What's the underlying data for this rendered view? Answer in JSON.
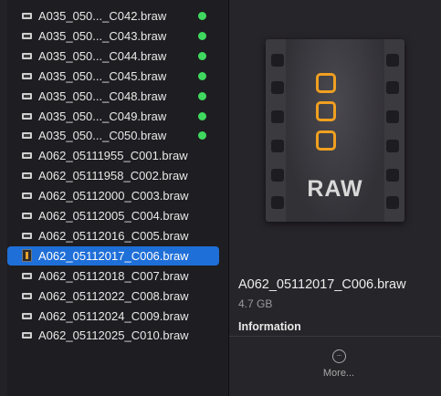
{
  "file_list": [
    {
      "name": "A035_050..._C042.braw",
      "tag": "green"
    },
    {
      "name": "A035_050..._C043.braw",
      "tag": "green"
    },
    {
      "name": "A035_050..._C044.braw",
      "tag": "green"
    },
    {
      "name": "A035_050..._C045.braw",
      "tag": "green"
    },
    {
      "name": "A035_050..._C048.braw",
      "tag": "green"
    },
    {
      "name": "A035_050..._C049.braw",
      "tag": "green"
    },
    {
      "name": "A035_050..._C050.braw",
      "tag": "green"
    },
    {
      "name": "A062_05111955_C001.braw",
      "tag": null
    },
    {
      "name": "A062_05111958_C002.braw",
      "tag": null
    },
    {
      "name": "A062_05112000_C003.braw",
      "tag": null
    },
    {
      "name": "A062_05112005_C004.braw",
      "tag": null
    },
    {
      "name": "A062_05112016_C005.braw",
      "tag": null
    },
    {
      "name": "A062_05112017_C006.braw",
      "tag": null,
      "selected": true
    },
    {
      "name": "A062_05112018_C007.braw",
      "tag": null
    },
    {
      "name": "A062_05112022_C008.braw",
      "tag": null
    },
    {
      "name": "A062_05112024_C009.braw",
      "tag": null
    },
    {
      "name": "A062_05112025_C010.braw",
      "tag": null
    }
  ],
  "colors": {
    "tag_green": "#3fd95f",
    "selection": "#1f6fd8",
    "raw_accent": "#f0a020"
  },
  "preview": {
    "icon_name": "braw-file-icon",
    "icon_label": "RAW",
    "title": "A062_05112017_C006.braw",
    "size": "4.7 GB",
    "info_heading": "Information",
    "more_label": "More...",
    "more_glyph": "···"
  }
}
